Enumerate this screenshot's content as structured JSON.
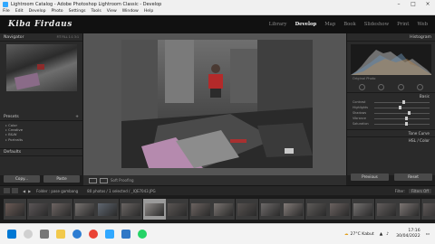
{
  "window": {
    "title": "Lightroom Catalog - Adobe Photoshop Lightroom Classic - Develop"
  },
  "menu": {
    "items": [
      "File",
      "Edit",
      "Develop",
      "Photo",
      "Settings",
      "Tools",
      "View",
      "Window",
      "Help"
    ]
  },
  "identity": {
    "logo": "Kiba Firdaus",
    "modules": [
      "Library",
      "Develop",
      "Map",
      "Book",
      "Slideshow",
      "Print",
      "Web"
    ],
    "active_module": "Develop"
  },
  "left_panel": {
    "navigator_label": "Navigator",
    "navigator_zoom": "FIT  FILL  1:1  3:1",
    "presets_label": "Presets",
    "preset_items": [
      "Color",
      "Creative",
      "B&W",
      "Portraits"
    ],
    "defaults_label": "Defaults",
    "copy_button": "Copy...",
    "paste_button": "Paste"
  },
  "right_panel": {
    "histogram_label": "Histogram",
    "original_photo_label": "Original Photo",
    "basic_label": "Basic",
    "sliders": [
      {
        "label": "Contrast",
        "value": 0.5
      },
      {
        "label": "Highlights",
        "value": 0.45
      },
      {
        "label": "Shadows",
        "value": 0.6
      },
      {
        "label": "Vibrance",
        "value": 0.55
      },
      {
        "label": "Saturation",
        "value": 0.55
      }
    ],
    "tone_curve_label": "Tone Curve",
    "hsl_label": "HSL / Color",
    "previous_button": "Previous",
    "reset_button": "Reset"
  },
  "toolbar": {
    "soft_proofing": "Soft Proofing"
  },
  "filmstrip_bar": {
    "path": "Folder : pase gambang",
    "count": "80 photos / 1 selected / _IQE7043.JPG",
    "filter_label": "Filter:",
    "filter_value": "Filters Off"
  },
  "filmstrip": {
    "thumbs": [
      {
        "color": "#6a5a55"
      },
      {
        "color": "#5b5556"
      },
      {
        "color": "#6d6462"
      },
      {
        "color": "#777270"
      },
      {
        "color": "#5f6670"
      },
      {
        "color": "#6a6563"
      },
      {
        "color": "#8e8a88"
      },
      {
        "color": "#5a5553"
      },
      {
        "color": "#6c6360"
      },
      {
        "color": "#7a7471"
      },
      {
        "color": "#56514f"
      },
      {
        "color": "#6e6a69"
      },
      {
        "color": "#837b78"
      },
      {
        "color": "#5d5a58"
      },
      {
        "color": "#6b6260"
      },
      {
        "color": "#747170"
      },
      {
        "color": "#625d5c"
      },
      {
        "color": "#7c7573"
      },
      {
        "color": "#5e5857"
      }
    ],
    "selected_index": 6
  },
  "taskbar": {
    "weather": "27°C  Kabut",
    "time": "17:16",
    "date": "30/04/2022"
  }
}
